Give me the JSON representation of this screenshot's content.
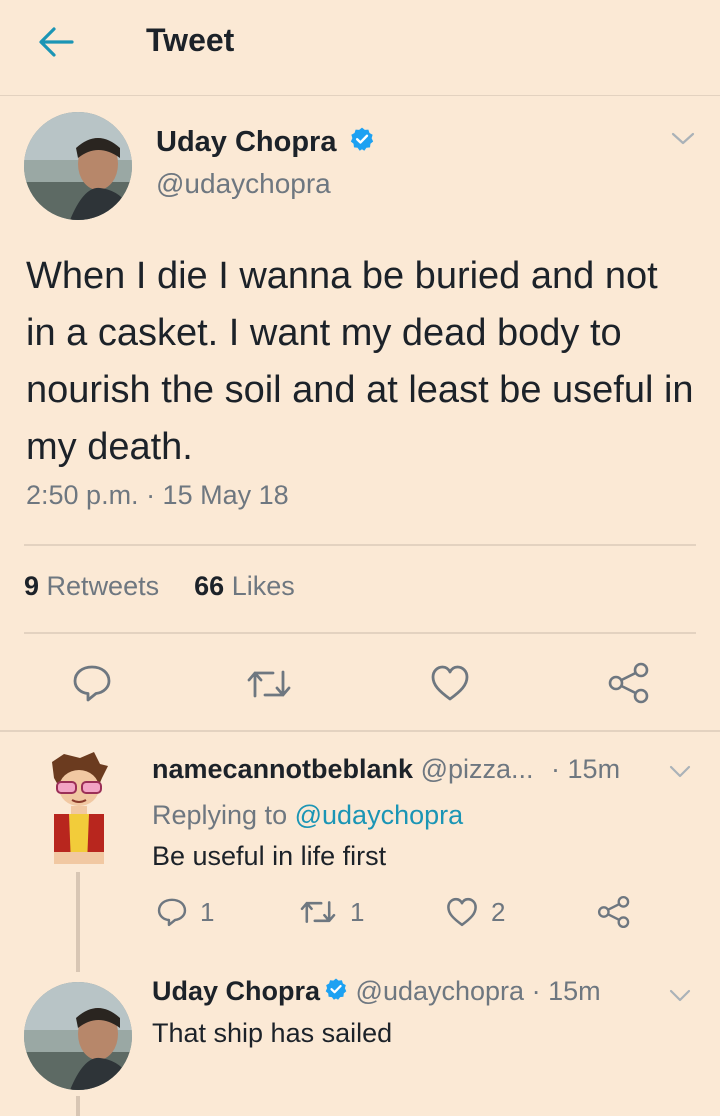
{
  "header": {
    "title": "Tweet"
  },
  "tweet": {
    "name": "Uday Chopra",
    "handle": "@udaychopra",
    "text": "When I die I wanna be buried and not in a casket. I want my dead body to nourish the soil and at least be useful in my death.",
    "time": "2:50 p.m. · 15 May 18",
    "retweets_count": "9",
    "retweets_label": "Retweets",
    "likes_count": "66",
    "likes_label": "Likes"
  },
  "replies": [
    {
      "name": "namecannotbeblank",
      "handle": "@pizza...",
      "time": "· 15m",
      "replying_prefix": "Replying to",
      "replying_handle": "@udaychopra",
      "text": "Be useful in life first",
      "reply_count": "1",
      "retweet_count": "1",
      "like_count": "2"
    },
    {
      "name": "Uday Chopra",
      "handle": "@udaychopra",
      "time": "· 15m",
      "text": "That ship has sailed"
    }
  ],
  "colors": {
    "background": "#fbe9d5",
    "accent": "#1b95b5",
    "verified": "#1da1f2",
    "secondary_text": "#6e7780"
  },
  "icons": [
    "back-arrow-icon",
    "verified-badge-icon",
    "chevron-down-icon",
    "reply-icon",
    "retweet-icon",
    "like-icon",
    "share-icon"
  ]
}
